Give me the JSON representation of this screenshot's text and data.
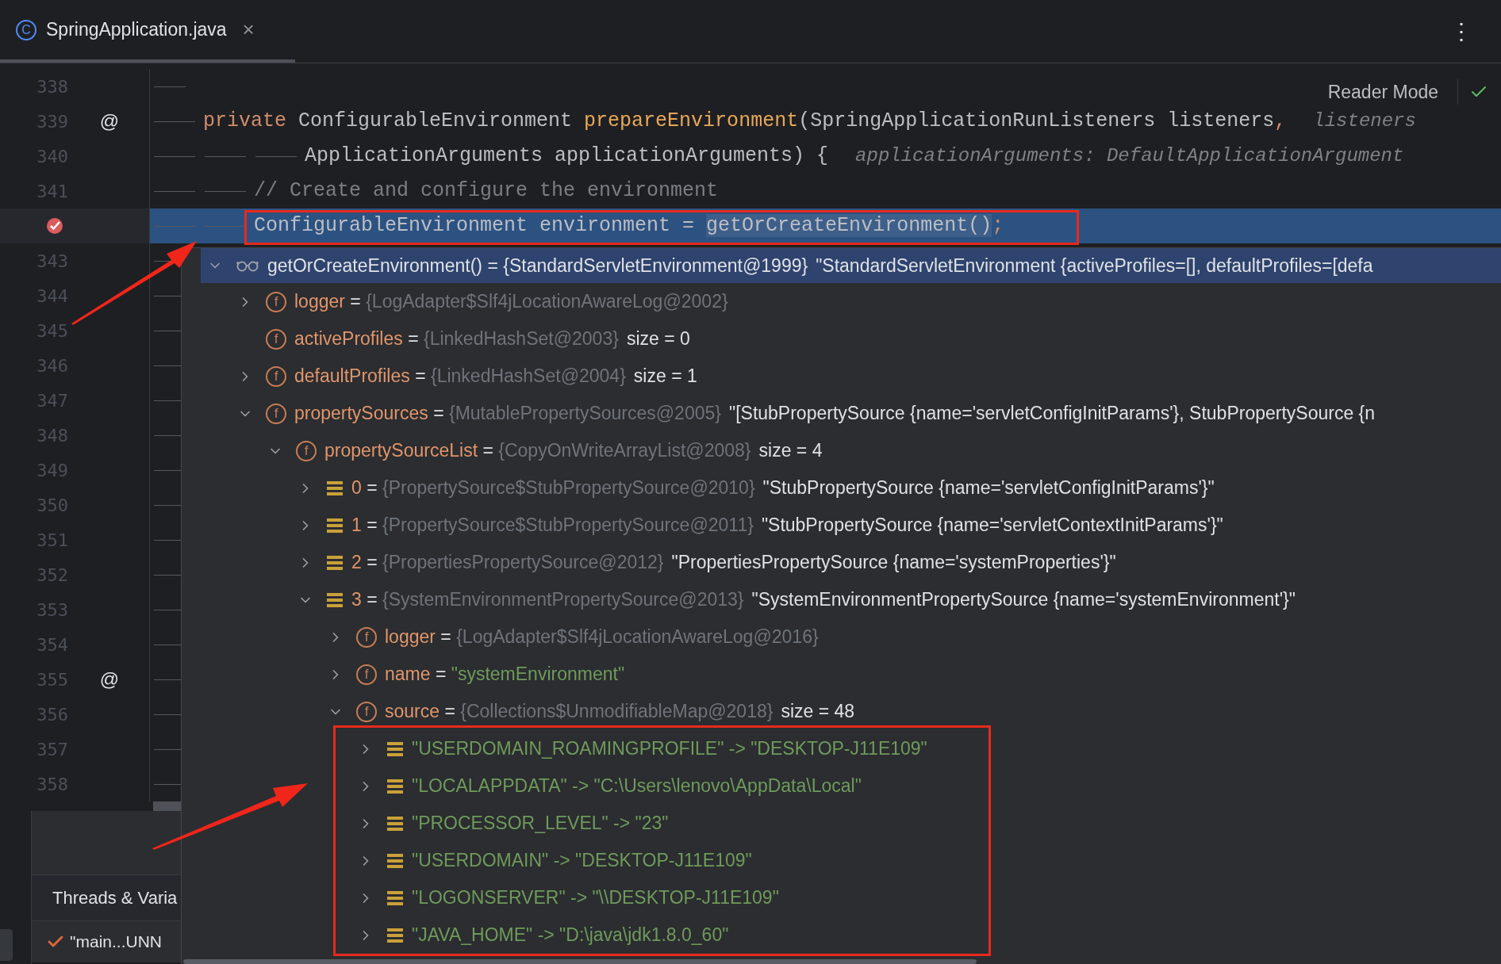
{
  "tab": {
    "badge": "C",
    "title": "SpringApplication.java",
    "close": "×",
    "selected": true
  },
  "more_menu": "⋮",
  "reader_mode": {
    "label": "Reader Mode"
  },
  "editor": {
    "lines": [
      {
        "number": "338",
        "breakpoint": false,
        "current": false
      },
      {
        "number": "339",
        "annotation": "@",
        "breakpoint": false,
        "current": false,
        "kind": "declaration",
        "code": [
          {
            "kind": "keyword",
            "text": "private"
          },
          {
            "kind": "plain",
            "text": " ConfigurableEnvironment "
          },
          {
            "kind": "method",
            "text": "prepareEnvironment"
          },
          {
            "kind": "plain",
            "text": "(SpringApplicationRunListeners listeners"
          },
          {
            "kind": "keyword",
            "text": ","
          }
        ],
        "hint": "listeners"
      },
      {
        "number": "340",
        "breakpoint": false,
        "current": false,
        "kind": "continuation",
        "code": [
          {
            "kind": "plain",
            "text": "ApplicationArguments applicationArguments) {"
          }
        ],
        "hint": "applicationArguments: DefaultApplicationArgument"
      },
      {
        "number": "341",
        "breakpoint": false,
        "current": false,
        "kind": "statement",
        "code": [
          {
            "kind": "comment",
            "text": "// Create and configure the environment"
          }
        ]
      },
      {
        "breakpoint": true,
        "current": true,
        "kind": "statement",
        "code": [
          {
            "kind": "plain",
            "text": "ConfigurableEnvironment environment = "
          },
          {
            "kind": "eval",
            "text": "getOrCreateEnvironment()"
          },
          {
            "kind": "keyword",
            "text": ";"
          }
        ]
      },
      {
        "number": "343",
        "breakpoint": false,
        "current": false
      },
      {
        "number": "344",
        "breakpoint": false,
        "current": false
      },
      {
        "number": "345",
        "breakpoint": false,
        "current": false
      },
      {
        "number": "346",
        "breakpoint": false,
        "current": false
      },
      {
        "number": "347",
        "breakpoint": false,
        "current": false
      },
      {
        "number": "348",
        "breakpoint": false,
        "current": false
      },
      {
        "number": "349",
        "breakpoint": false,
        "current": false
      },
      {
        "number": "350",
        "breakpoint": false,
        "current": false
      },
      {
        "number": "351",
        "breakpoint": false,
        "current": false
      },
      {
        "number": "352",
        "breakpoint": false,
        "current": false
      },
      {
        "number": "353",
        "breakpoint": false,
        "current": false
      },
      {
        "number": "354",
        "breakpoint": false,
        "current": false
      },
      {
        "number": "355",
        "annotation": "@",
        "breakpoint": false,
        "current": false
      },
      {
        "number": "356",
        "breakpoint": false,
        "current": false
      },
      {
        "number": "357",
        "breakpoint": false,
        "current": false
      },
      {
        "number": "358",
        "breakpoint": false,
        "current": false
      }
    ]
  },
  "evaluation_tree": [
    {
      "kind": "watch",
      "expandable": true,
      "expanded": true,
      "selected": true,
      "name": "getOrCreateEnvironment()",
      "eq": "=",
      "type": "{StandardServletEnvironment@1999}",
      "value": "\"StandardServletEnvironment {activeProfiles=[], defaultProfiles=[defa",
      "children": [
        {
          "kind": "field",
          "badge": "f",
          "expandable": true,
          "expanded": false,
          "selected": false,
          "name": "logger",
          "eq": "=",
          "type": "{LogAdapter$Slf4jLocationAwareLog@2002}"
        },
        {
          "kind": "field",
          "badge": "f",
          "expandable": false,
          "selected": false,
          "name": "activeProfiles",
          "eq": "=",
          "type": "{LinkedHashSet@2003}",
          "value": "size = 0"
        },
        {
          "kind": "field",
          "badge": "f",
          "expandable": true,
          "expanded": false,
          "selected": false,
          "name": "defaultProfiles",
          "eq": "=",
          "type": "{LinkedHashSet@2004}",
          "value": "size = 1"
        },
        {
          "kind": "field",
          "badge": "f",
          "expandable": true,
          "expanded": true,
          "selected": false,
          "name": "propertySources",
          "eq": "=",
          "type": "{MutablePropertySources@2005}",
          "value": "\"[StubPropertySource {name='servletConfigInitParams'}, StubPropertySource {n",
          "children": [
            {
              "kind": "field",
              "badge": "f",
              "expandable": true,
              "expanded": true,
              "selected": false,
              "name": "propertySourceList",
              "eq": "=",
              "type": "{CopyOnWriteArrayList@2008}",
              "value": "size = 4",
              "children": [
                {
                  "kind": "item",
                  "expandable": true,
                  "expanded": false,
                  "selected": false,
                  "name": "0",
                  "eq": "=",
                  "type": "{PropertySource$StubPropertySource@2010}",
                  "value": "\"StubPropertySource {name='servletConfigInitParams'}\""
                },
                {
                  "kind": "item",
                  "expandable": true,
                  "expanded": false,
                  "selected": false,
                  "name": "1",
                  "eq": "=",
                  "type": "{PropertySource$StubPropertySource@2011}",
                  "value": "\"StubPropertySource {name='servletContextInitParams'}\""
                },
                {
                  "kind": "item",
                  "expandable": true,
                  "expanded": false,
                  "selected": false,
                  "name": "2",
                  "eq": "=",
                  "type": "{PropertiesPropertySource@2012}",
                  "value": "\"PropertiesPropertySource {name='systemProperties'}\""
                },
                {
                  "kind": "item",
                  "expandable": true,
                  "expanded": true,
                  "selected": false,
                  "name": "3",
                  "eq": "=",
                  "type": "{SystemEnvironmentPropertySource@2013}",
                  "value": "\"SystemEnvironmentPropertySource {name='systemEnvironment'}\"",
                  "children": [
                    {
                      "kind": "field",
                      "badge": "f",
                      "expandable": true,
                      "expanded": false,
                      "selected": false,
                      "name": "logger",
                      "eq": "=",
                      "type": "{LogAdapter$Slf4jLocationAwareLog@2016}"
                    },
                    {
                      "kind": "string_field",
                      "badge": "f",
                      "expandable": true,
                      "expanded": false,
                      "selected": false,
                      "name": "name",
                      "eq": "=",
                      "value": "\"systemEnvironment\""
                    },
                    {
                      "kind": "field",
                      "badge": "f",
                      "expandable": true,
                      "expanded": true,
                      "selected": false,
                      "name": "source",
                      "eq": "=",
                      "type": "{Collections$UnmodifiableMap@2018}",
                      "value": "size = 48",
                      "children": [
                        {
                          "kind": "map_entry",
                          "expandable": true,
                          "expanded": false,
                          "selected": false,
                          "name": "\"USERDOMAIN_ROAMINGPROFILE\"",
                          "eq": "->",
                          "value": "\"DESKTOP-J11E109\""
                        },
                        {
                          "kind": "map_entry",
                          "expandable": true,
                          "expanded": false,
                          "selected": false,
                          "name": "\"LOCALAPPDATA\"",
                          "eq": "->",
                          "value": "\"C:\\Users\\lenovo\\AppData\\Local\""
                        },
                        {
                          "kind": "map_entry",
                          "expandable": true,
                          "expanded": false,
                          "selected": false,
                          "name": "\"PROCESSOR_LEVEL\"",
                          "eq": "->",
                          "value": "\"23\""
                        },
                        {
                          "kind": "map_entry",
                          "expandable": true,
                          "expanded": false,
                          "selected": false,
                          "name": "\"USERDOMAIN\"",
                          "eq": "->",
                          "value": "\"DESKTOP-J11E109\""
                        },
                        {
                          "kind": "map_entry",
                          "expandable": true,
                          "expanded": false,
                          "selected": false,
                          "name": "\"LOGONSERVER\"",
                          "eq": "->",
                          "value": "\"\\\\DESKTOP-J11E109\""
                        },
                        {
                          "kind": "map_entry",
                          "expandable": true,
                          "expanded": false,
                          "selected": false,
                          "name": "\"JAVA_HOME\"",
                          "eq": "->",
                          "value": "\"D:\\java\\jdk1.8.0_60\""
                        }
                      ]
                    }
                  ]
                }
              ]
            }
          ]
        }
      ]
    }
  ],
  "debug_panel": {
    "tabs": [
      {
        "label": "Threads & Varia",
        "selected": true
      }
    ],
    "frames": [
      {
        "label": "\"main...UNN",
        "selected": true
      }
    ]
  }
}
